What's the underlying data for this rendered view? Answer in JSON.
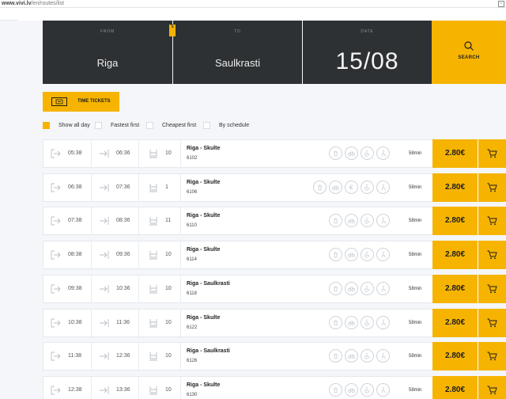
{
  "browser": {
    "url_host": "www.vivi.lv",
    "url_path": "/en/routes/list"
  },
  "search": {
    "from_label": "FROM",
    "from_value": "Riga",
    "to_label": "TO",
    "to_value": "Saulkrasti",
    "date_label": "DATE",
    "date_value": "15/08",
    "button_label": "SEARCH",
    "swap_glyph": "⇅"
  },
  "time_tickets_label": "TIME TICKETS",
  "filters": [
    {
      "label": "Show all day",
      "active": true
    },
    {
      "label": "Fastest first",
      "active": false
    },
    {
      "label": "Cheapest first",
      "active": false
    },
    {
      "label": "By schedule",
      "active": false
    }
  ],
  "amenity_icons": [
    "trash-icon",
    "bicycle-icon",
    "wheelchair-icon",
    "person-stroller-icon"
  ],
  "amenity_icons_extended": [
    "trash-icon",
    "bicycle-icon",
    "euro-icon",
    "wheelchair-icon",
    "person-stroller-icon"
  ],
  "colors": {
    "accent": "#f6b400",
    "panel": "#2e3133",
    "background": "#f4f6f9"
  },
  "trips": [
    {
      "depart": "05:38",
      "arrive": "06:36",
      "seats": "10",
      "route": "Riga - Skulte",
      "train": "6102",
      "duration": "58min",
      "price": "2.80€",
      "extended_icons": false
    },
    {
      "depart": "06:38",
      "arrive": "07:36",
      "seats": "1",
      "route": "Riga - Skulte",
      "train": "6106",
      "duration": "58min",
      "price": "2.80€",
      "extended_icons": true
    },
    {
      "depart": "07:38",
      "arrive": "08:36",
      "seats": "11",
      "route": "Riga - Skulte",
      "train": "6110",
      "duration": "58min",
      "price": "2.80€",
      "extended_icons": false
    },
    {
      "depart": "08:38",
      "arrive": "09:36",
      "seats": "10",
      "route": "Riga - Skulte",
      "train": "6114",
      "duration": "58min",
      "price": "2.80€",
      "extended_icons": false
    },
    {
      "depart": "09:38",
      "arrive": "10:36",
      "seats": "10",
      "route": "Riga - Saulkrasti",
      "train": "6118",
      "duration": "58min",
      "price": "2.80€",
      "extended_icons": false
    },
    {
      "depart": "10:38",
      "arrive": "11:36",
      "seats": "10",
      "route": "Riga - Skulte",
      "train": "6122",
      "duration": "58min",
      "price": "2.80€",
      "extended_icons": false
    },
    {
      "depart": "11:38",
      "arrive": "12:36",
      "seats": "10",
      "route": "Riga - Saulkrasti",
      "train": "6126",
      "duration": "58min",
      "price": "2.80€",
      "extended_icons": false
    },
    {
      "depart": "12:38",
      "arrive": "13:36",
      "seats": "10",
      "route": "Riga - Skulte",
      "train": "6130",
      "duration": "58min",
      "price": "2.80€",
      "extended_icons": false
    }
  ]
}
